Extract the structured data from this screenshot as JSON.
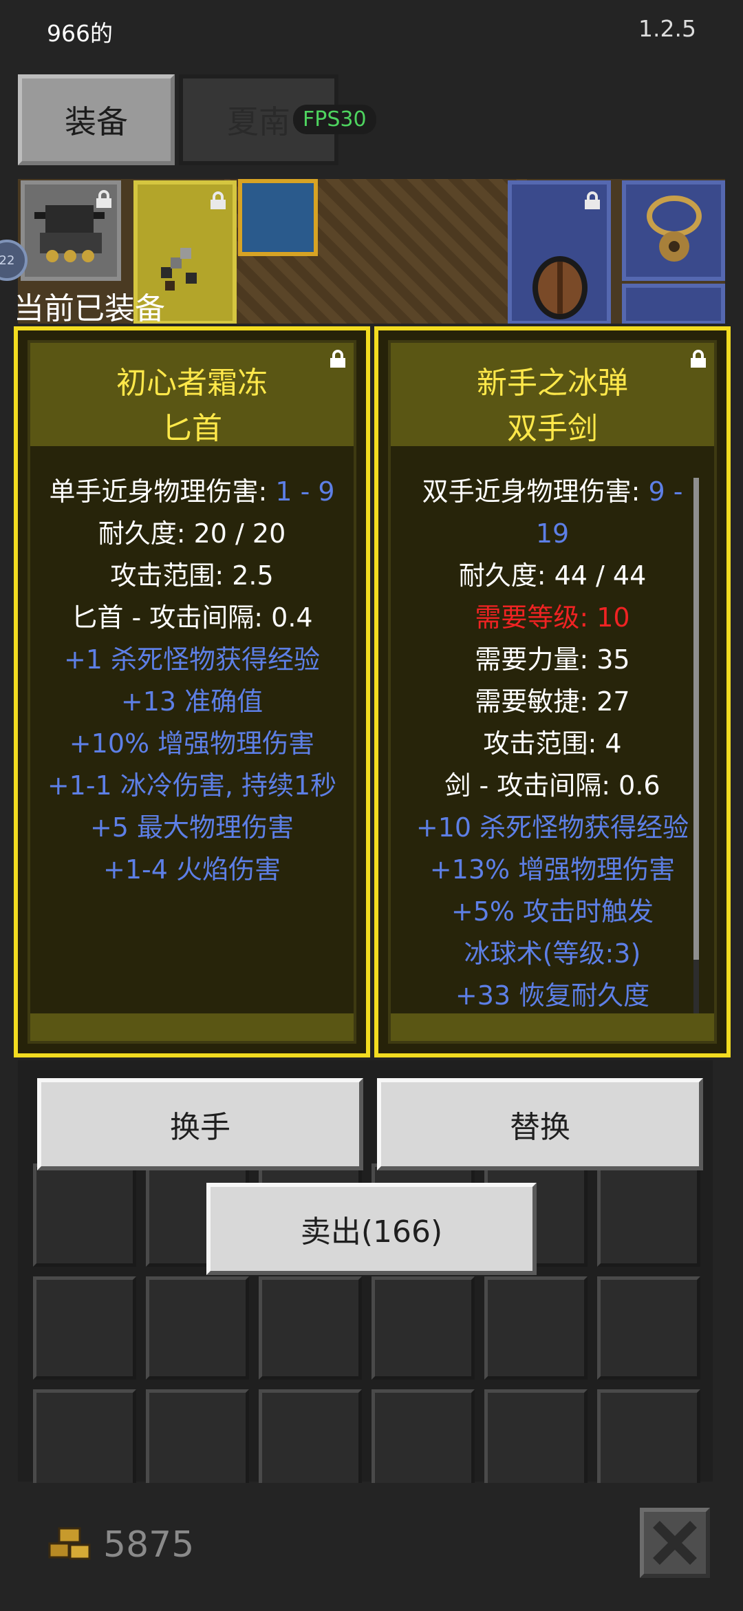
{
  "status_bar": {
    "left_text": "966的",
    "version": "1.2.5"
  },
  "tabs": [
    {
      "label": "装备",
      "active": true
    },
    {
      "label": "夏南",
      "active": false
    }
  ],
  "fps_badge": "FPS30",
  "level_badge": "22",
  "section_label": "当前已装备",
  "cards": [
    {
      "title_line1": "初心者霜冻",
      "title_line2": "匕首",
      "stats": [
        {
          "text": "单手近身物理伤害: ",
          "value": "1 - 9"
        },
        {
          "text": "耐久度: 20 / 20"
        },
        {
          "text": "攻击范围: 2.5"
        },
        {
          "text": "匕首 - 攻击间隔: 0.4"
        },
        {
          "text": "+1 杀死怪物获得经验"
        },
        {
          "text": "+13 准确值"
        },
        {
          "text": "+10% 增强物理伤害"
        },
        {
          "text": "+1-1 冰冷伤害, 持续1秒"
        },
        {
          "text": "+5 最大物理伤害"
        },
        {
          "text": "+1-4 火焰伤害"
        }
      ]
    },
    {
      "title_line1": "新手之冰弹",
      "title_line2": "双手剑",
      "stats": [
        {
          "text": "双手近身物理伤害: ",
          "value": "9 -"
        },
        {
          "text": "19"
        },
        {
          "text": "耐久度: 44 / 44"
        },
        {
          "text": "需要等级: 10"
        },
        {
          "text": "需要力量: 35"
        },
        {
          "text": "需要敏捷: 27"
        },
        {
          "text": "攻击范围: 4"
        },
        {
          "text": "剑 - 攻击间隔: 0.6"
        },
        {
          "text": "+10 杀死怪物获得经验"
        },
        {
          "text": "+13% 增强物理伤害"
        },
        {
          "text": "+5% 攻击时触发"
        },
        {
          "text": "冰球术(等级:3)"
        },
        {
          "text": "+33 恢复耐久度"
        }
      ]
    }
  ],
  "buttons": {
    "swap_hand": "换手",
    "replace": "替换",
    "sell": "卖出(166)"
  },
  "gold": "5875",
  "colors": {
    "card_border": "#f3dc20",
    "title": "#ffe84a",
    "bonus": "#5d7fe6",
    "requirement_unmet": "#ef2323",
    "fps": "#4ed45f"
  }
}
